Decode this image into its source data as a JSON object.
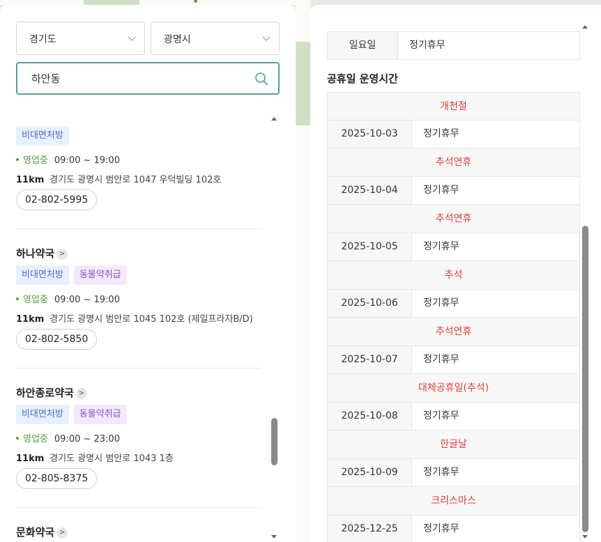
{
  "filters": {
    "province": "경기도",
    "city": "광명시",
    "search_value": "하안동"
  },
  "pharmacies": [
    {
      "name": "",
      "tags": [
        {
          "label": "비대면처방",
          "color": "blue"
        }
      ],
      "status": "영업중",
      "hours": "09:00 ~ 19:00",
      "distance": "11km",
      "address": "경기도 광명시 범안로 1047 우덕빌딩 102호",
      "phone": "02-802-5995"
    },
    {
      "name": "하나약국",
      "tags": [
        {
          "label": "비대면처방",
          "color": "blue"
        },
        {
          "label": "동물약취급",
          "color": "purple"
        }
      ],
      "status": "영업중",
      "hours": "09:00 ~ 19:00",
      "distance": "11km",
      "address": "경기도 광명시 범안로 1045 102호 (제일프라자B/D)",
      "phone": "02-802-5850"
    },
    {
      "name": "하안종로약국",
      "tags": [
        {
          "label": "비대면처방",
          "color": "blue"
        },
        {
          "label": "동물약취급",
          "color": "purple"
        }
      ],
      "status": "영업중",
      "hours": "09:00 ~ 23:00",
      "distance": "11km",
      "address": "경기도 광명시 범안로 1043 1층",
      "phone": "02-805-8375"
    },
    {
      "name": "문화약국",
      "tags": [
        {
          "label": "",
          "color": "blue"
        },
        {
          "label": "",
          "color": "purple"
        }
      ]
    }
  ],
  "detail": {
    "sunday": {
      "day": "일요일",
      "value": "정기휴무"
    },
    "holiday_title": "공휴일 운영시간",
    "holidays": [
      {
        "name": "개천절",
        "date": "2025-10-03",
        "status": "정기휴무"
      },
      {
        "name": "추석연휴",
        "date": "2025-10-04",
        "status": "정기휴무"
      },
      {
        "name": "추석연휴",
        "date": "2025-10-05",
        "status": "정기휴무"
      },
      {
        "name": "추석",
        "date": "2025-10-06",
        "status": "정기휴무"
      },
      {
        "name": "추석연휴",
        "date": "2025-10-07",
        "status": "정기휴무"
      },
      {
        "name": "대체공휴일(추석)",
        "date": "2025-10-08",
        "status": "정기휴무"
      },
      {
        "name": "한글날",
        "date": "2025-10-09",
        "status": "정기휴무"
      },
      {
        "name": "크리스마스",
        "date": "2025-12-25",
        "status": "정기휴무"
      }
    ]
  },
  "colors": {
    "accent": "#5a9ea5",
    "open_green": "#4f9d3a",
    "holiday_red": "#e0413b",
    "tag_blue_text": "#4b6fc7",
    "tag_purple_text": "#8d52c6"
  },
  "icons": {
    "search": "search-icon",
    "chevron": "chevron-down-icon",
    "detail_arrow": "chevron-right-icon"
  }
}
